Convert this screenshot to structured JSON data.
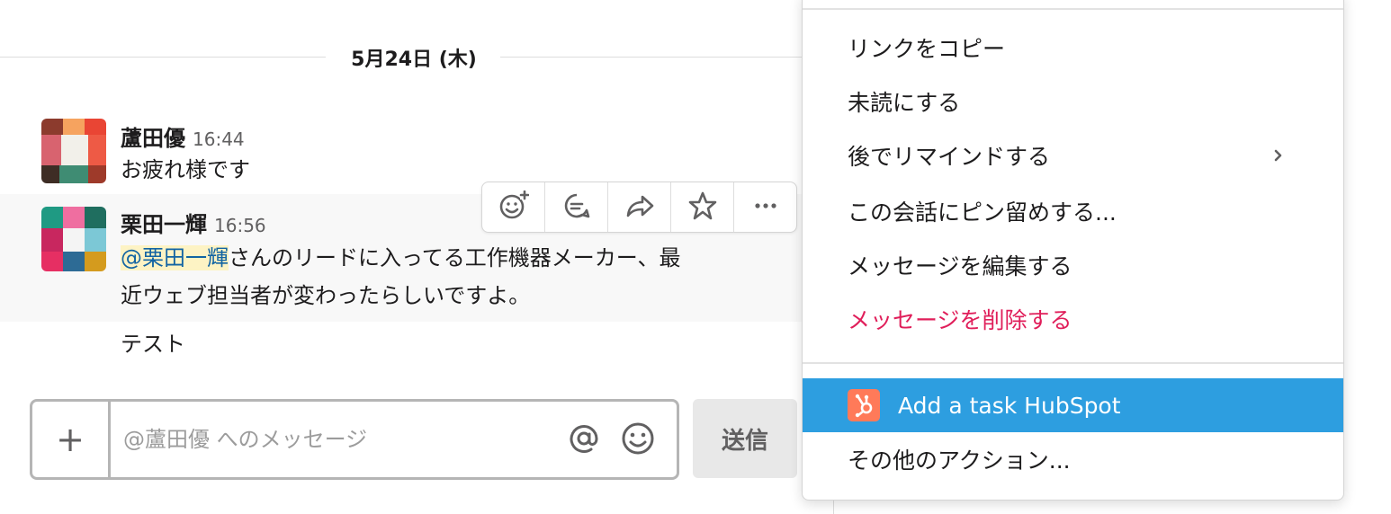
{
  "date_divider": "5月24日 (木)",
  "messages": [
    {
      "sender": "蘆田優",
      "time": "16:44",
      "text": "お疲れ様です"
    },
    {
      "sender": "栗田一輝",
      "time": "16:56",
      "mention": "@栗田一輝",
      "text_line1": "さんのリードに入ってる工作機器メーカー、最",
      "text_line2": "近ウェブ担当者が変わったらしいですよ。"
    },
    {
      "text": "テスト"
    }
  ],
  "toolbar": {
    "icons": [
      "add-reaction-icon",
      "comment-icon",
      "share-icon",
      "star-icon",
      "more-icon"
    ]
  },
  "composer": {
    "plus_label": "+",
    "placeholder": "@蘆田優 へのメッセージ",
    "send_label": "送信"
  },
  "menu": {
    "items": [
      {
        "label": "リンクをコピー"
      },
      {
        "label": "未読にする"
      },
      {
        "label": "後でリマインドする"
      },
      {
        "label": "この会話にピン留めする..."
      },
      {
        "label": "メッセージを編集する"
      },
      {
        "label": "メッセージを削除する"
      }
    ],
    "hubspot_label": "Add a task HubSpot",
    "more_actions_label": "その他のアクション..."
  },
  "colors": {
    "danger": "#e01e5a",
    "highlight": "#2d9ee0",
    "mention_bg": "#fdf3c4",
    "mention_text": "#1264a3",
    "hubspot": "#ff7a59"
  }
}
